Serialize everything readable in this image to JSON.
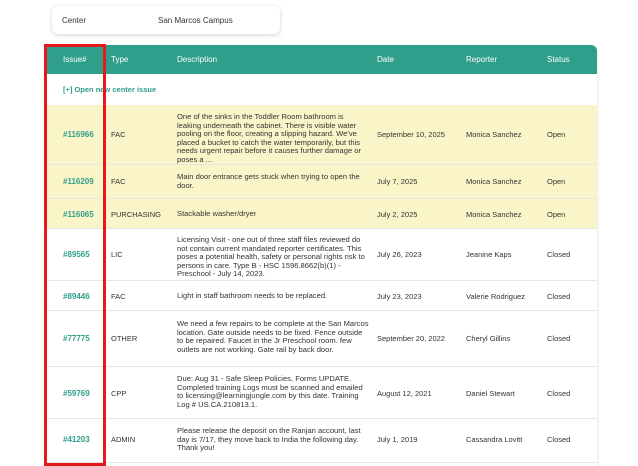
{
  "center": {
    "label": "Center",
    "value": "San Marcos Campus"
  },
  "table": {
    "headers": [
      "Issue#",
      "Type",
      "Description",
      "Date",
      "Reporter",
      "Status"
    ],
    "open_new_link": "[+] Open new center issue",
    "rows": [
      {
        "issue": "#116966",
        "type": "FAC",
        "description": "One of the sinks in the Toddler Room bathroom is leaking underneath the cabinet. There is visible water pooling on the floor, creating a slipping hazard. We've placed a bucket to catch the water temporarily, but this needs urgent repair before it causes further damage or poses a ...",
        "date": "September 10, 2025",
        "reporter": "Monica Sanchez",
        "status": "Open"
      },
      {
        "issue": "#116209",
        "type": "FAC",
        "description": "Main door entrance gets stuck when trying to open the door.",
        "date": "July 7, 2025",
        "reporter": "Monica Sanchez",
        "status": "Open"
      },
      {
        "issue": "#116065",
        "type": "PURCHASING",
        "description": "Stackable washer/dryer",
        "date": "July 2, 2025",
        "reporter": "Monica Sanchez",
        "status": "Open"
      },
      {
        "issue": "#89565",
        "type": "LIC",
        "description": "Licensing Visit - one out of three staff files reviewed do not contain current mandated reporter certificates. This poses a potential health, safety or personal rights risk to persons in care. Type B - HSC 1596.8662(b)(1) - Preschool - July 14, 2023.",
        "date": "July 26, 2023",
        "reporter": "Jeanine Kaps",
        "status": "Closed"
      },
      {
        "issue": "#89446",
        "type": "FAC",
        "description": "Light in staff bathroom needs to be replaced.",
        "date": "July 23, 2023",
        "reporter": "Valerie Rodriguez",
        "status": "Closed"
      },
      {
        "issue": "#77775",
        "type": "OTHER",
        "description": "We need a few repairs to be complete at the San Marcos location. Gate outside needs to be fixed. Fence outside to be repaired. Faucet in the Jr Preschool room. few outlets are not working. Gate rail by back door.",
        "date": "September 20, 2022",
        "reporter": "Cheryl Gillins",
        "status": "Closed"
      },
      {
        "issue": "#59769",
        "type": "CPP",
        "description": "Due: Aug 31 - Safe Sleep Policies, Forms UPDATE. Completed training Logs must be scanned and emailed to licensing@learningjungle.com by this date. Training Log # US.CA.210813.1.",
        "date": "August 12, 2021",
        "reporter": "Daniel Stewart",
        "status": "Closed"
      },
      {
        "issue": "#41203",
        "type": "ADMIN",
        "description": "Please release the deposit on the Ranjan account, last day is 7/17, they move back to India the following day. Thank you!",
        "date": "July 1, 2019",
        "reporter": "Cassandra Lovitt",
        "status": "Closed"
      }
    ]
  },
  "colors": {
    "header_bg": "#2f9e8a",
    "open_row_bg": "#faf5c8",
    "highlight_box": "#e3191c"
  }
}
